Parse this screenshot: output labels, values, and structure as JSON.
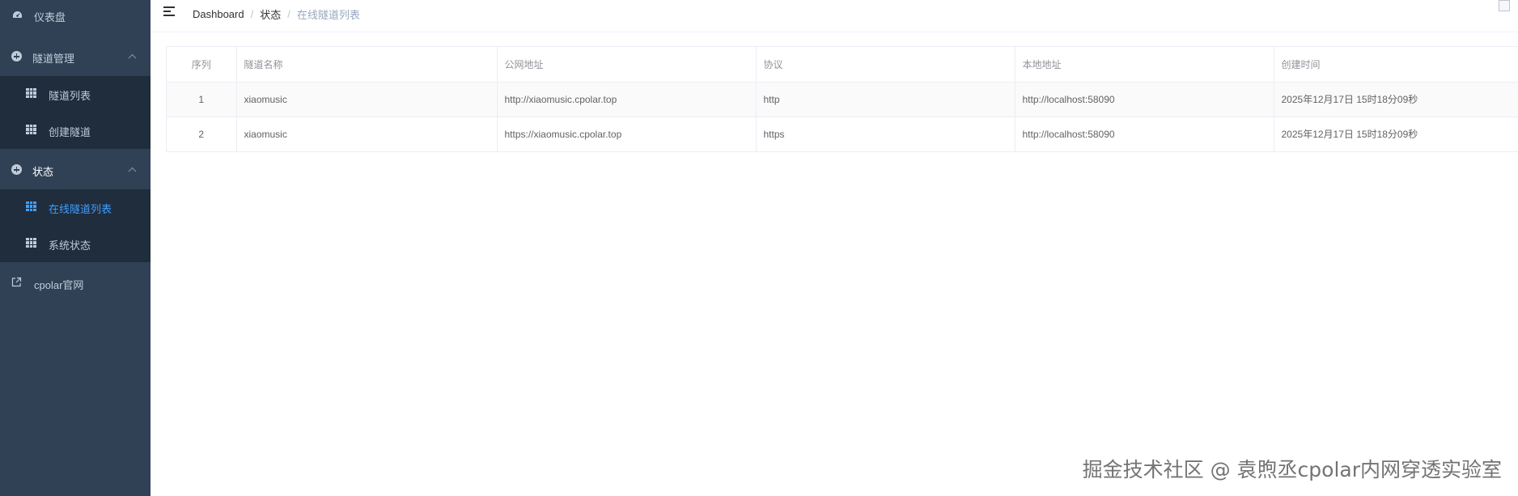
{
  "sidebar": {
    "dashboard": {
      "label": "仪表盘",
      "icon": "dashboard-icon"
    },
    "tunnel_mgmt": {
      "label": "隧道管理",
      "icon": "plus-circle-icon",
      "items": [
        {
          "label": "隧道列表",
          "icon": "table-icon"
        },
        {
          "label": "创建隧道",
          "icon": "table-icon"
        }
      ]
    },
    "status": {
      "label": "状态",
      "icon": "plus-circle-icon",
      "items": [
        {
          "label": "在线隧道列表",
          "icon": "table-icon",
          "active": true
        },
        {
          "label": "系统状态",
          "icon": "table-icon"
        }
      ]
    },
    "cpolar_site": {
      "label": "cpolar官网",
      "icon": "external-link-icon"
    }
  },
  "navbar": {
    "breadcrumb": [
      "Dashboard",
      "状态",
      "在线隧道列表"
    ]
  },
  "table": {
    "columns": [
      "序列",
      "隧道名称",
      "公网地址",
      "协议",
      "本地地址",
      "创建时间"
    ],
    "rows": [
      [
        "1",
        "xiaomusic",
        "http://xiaomusic.cpolar.top",
        "http",
        "http://localhost:58090",
        "2025年12月17日 15时18分09秒"
      ],
      [
        "2",
        "xiaomusic",
        "https://xiaomusic.cpolar.top",
        "https",
        "http://localhost:58090",
        "2025年12月17日 15时18分09秒"
      ]
    ]
  },
  "watermark": "掘金技术社区 @ 袁煦丞cpolar内网穿透实验室",
  "colors": {
    "sidebar_bg": "#304156",
    "submenu_bg": "#1f2d3d",
    "active": "#409eff",
    "menu_text": "#bfcbd9"
  }
}
